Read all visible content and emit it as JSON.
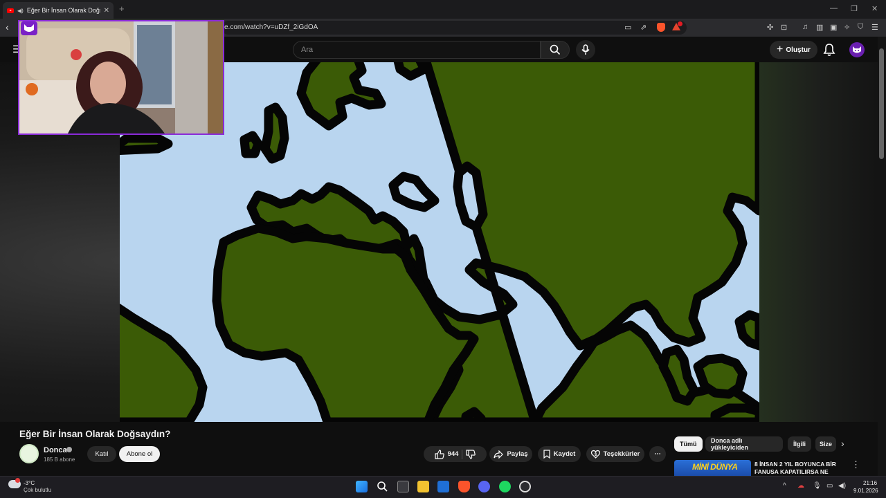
{
  "browser": {
    "tab_title": "Eğer Bir İnsan Olarak Doğsayd",
    "new_tab": "+",
    "url": "e.com/watch?v=uDZf_2iGdOA",
    "minimize": "—",
    "maximize": "❐",
    "close": "✕",
    "back": "‹"
  },
  "youtube": {
    "search_placeholder": "Ara",
    "create_label": "Oluştur",
    "plus_glyph": "+"
  },
  "video": {
    "title": "Eğer Bir İnsan Olarak Doğsaydın?",
    "channel": {
      "name": "Donca",
      "subscribers": "185 B abone",
      "join_label": "Katıl",
      "subscribe_label": "Abone ol"
    },
    "actions": {
      "like_count": "944",
      "share_label": "Paylaş",
      "save_label": "Kaydet",
      "thanks_label": "Teşekkürler",
      "more": "⋯"
    },
    "map_colors": {
      "land": "#3b5b06",
      "sea": "#b9d5ef",
      "outline": "#050505"
    }
  },
  "sidebar": {
    "chips": [
      "Tümü",
      "Donca adlı yükleyiciden",
      "İlgili",
      "Size"
    ],
    "next_glyph": "›",
    "recommendation": {
      "thumb_text": "MİNİ DÜNYA",
      "title": "8 İNSAN 2 YIL BOYUNCA BİR FANUSA KAPATILIRSA NE",
      "more": "⋮"
    }
  },
  "taskbar": {
    "temperature": "-3°C",
    "weather": "Çok bulutlu",
    "time": "21:16",
    "date": "9.01.2026",
    "tray_up": "^"
  },
  "colors": {
    "accent": "#8a2ad8",
    "youtube_red": "#ff0000"
  }
}
